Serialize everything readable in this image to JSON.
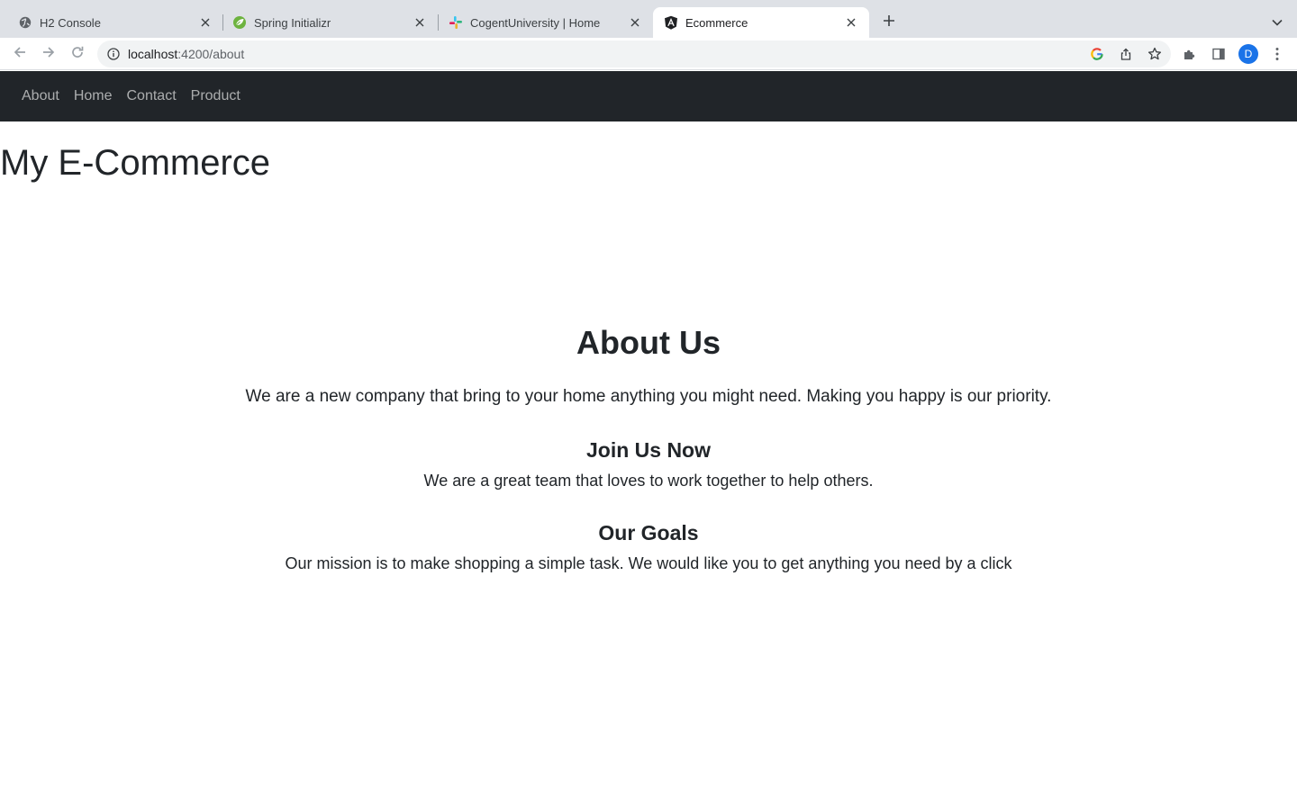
{
  "browser": {
    "tabs": [
      {
        "title": "H2 Console",
        "icon": "globe-icon",
        "active": false
      },
      {
        "title": "Spring Initializr",
        "icon": "spring-icon",
        "active": false
      },
      {
        "title": "CogentUniversity | Home",
        "icon": "slack-icon",
        "active": false
      },
      {
        "title": "Ecommerce",
        "icon": "angular-icon",
        "active": true
      }
    ],
    "url_host": "localhost",
    "url_path": ":4200/about",
    "profile_initial": "D"
  },
  "navbar": {
    "links": [
      "About",
      "Home",
      "Contact",
      "Product"
    ]
  },
  "page": {
    "title": "My E-Commerce"
  },
  "about": {
    "heading": "About Us",
    "lead": "We are a new company that bring to your home anything you might need. Making you happy is our priority.",
    "sections": [
      {
        "heading": "Join Us Now",
        "text": "We are a great team that loves to work together to help others."
      },
      {
        "heading": "Our Goals",
        "text": "Our mission is to make shopping a simple task. We would like you to get anything you need by a click"
      }
    ]
  },
  "colors": {
    "navbar_bg": "#212529",
    "tabstrip_bg": "#dee1e6",
    "text": "#212529"
  }
}
